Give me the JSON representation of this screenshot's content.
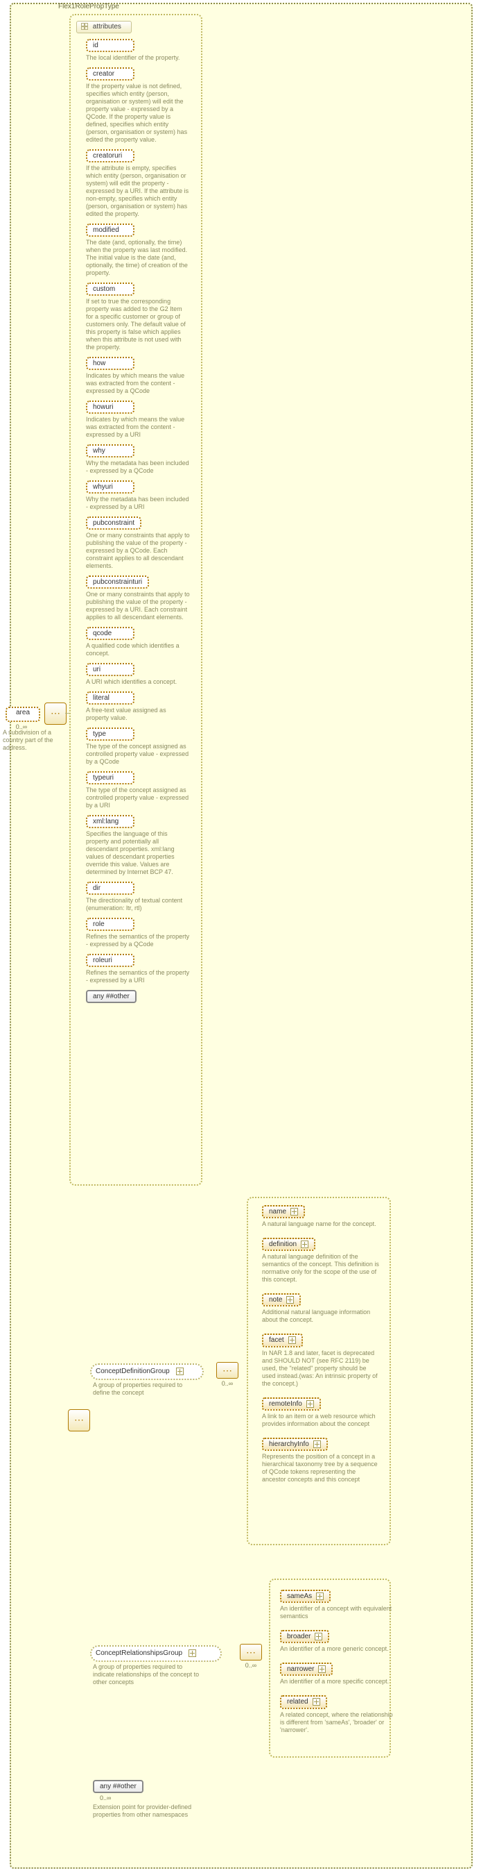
{
  "root_type": "Flex1RolePropType",
  "attributes_label": "attributes",
  "area": {
    "label": "area",
    "occ": "0..∞",
    "desc": "A subdivision of a country part of the address."
  },
  "attrs": [
    {
      "name": "id",
      "desc": "The local identifier of the property."
    },
    {
      "name": "creator",
      "desc": "If the property value is not defined, specifies which entity (person, organisation or system) will edit the property value - expressed by a QCode. If the property value is defined, specifies which entity (person, organisation or system) has edited the property value."
    },
    {
      "name": "creatoruri",
      "desc": "If the attribute is empty, specifies which entity (person, organisation or system) will edit the property - expressed by a URI. If the attribute is non-empty, specifies which entity (person, organisation or system) has edited the property."
    },
    {
      "name": "modified",
      "desc": "The date (and, optionally, the time) when the property was last modified. The initial value is the date (and, optionally, the time) of creation of the property."
    },
    {
      "name": "custom",
      "desc": "If set to true the corresponding property was added to the G2 Item for a specific customer or group of customers only. The default value of this property is false which applies when this attribute is not used with the property."
    },
    {
      "name": "how",
      "desc": "Indicates by which means the value was extracted from the content - expressed by a QCode"
    },
    {
      "name": "howuri",
      "desc": "Indicates by which means the value was extracted from the content - expressed by a URI"
    },
    {
      "name": "why",
      "desc": "Why the metadata has been included - expressed by a QCode"
    },
    {
      "name": "whyuri",
      "desc": "Why the metadata has been included - expressed by a URI"
    },
    {
      "name": "pubconstraint",
      "desc": "One or many constraints that apply to publishing the value of the property - expressed by a QCode. Each constraint applies to all descendant elements."
    },
    {
      "name": "pubconstrainturi",
      "desc": "One or many constraints that apply to publishing the value of the property - expressed by a URI. Each constraint applies to all descendant elements."
    },
    {
      "name": "qcode",
      "desc": "A qualified code which identifies a concept."
    },
    {
      "name": "uri",
      "desc": "A URI which identifies a concept."
    },
    {
      "name": "literal",
      "desc": "A free-text value assigned as property value."
    },
    {
      "name": "type",
      "desc": "The type of the concept assigned as controlled property value - expressed by a QCode"
    },
    {
      "name": "typeuri",
      "desc": "The type of the concept assigned as controlled property value - expressed by a URI"
    },
    {
      "name": "xml:lang",
      "desc": "Specifies the language of this property and potentially all descendant properties. xml:lang values of descendant properties override this value. Values are determined by Internet BCP 47."
    },
    {
      "name": "dir",
      "desc": "The directionality of textual content (enumeration: ltr, rtl)"
    },
    {
      "name": "role",
      "desc": "Refines the semantics of the property - expressed by a QCode"
    },
    {
      "name": "roleuri",
      "desc": "Refines the semantics of the property - expressed by a URI"
    }
  ],
  "any_other": "any ##other",
  "cdg": {
    "label": "ConceptDefinitionGroup",
    "desc": "A group of properties required to define the concept"
  },
  "crg": {
    "label": "ConceptRelationshipsGroup",
    "desc": "A group of properties required to indicate relationships of the concept to other concepts"
  },
  "zero_inf": "0..∞",
  "details1": [
    {
      "name": "name",
      "dotted": true,
      "desc": "A natural language name for the concept."
    },
    {
      "name": "definition",
      "dotted": true,
      "desc": "A natural language definition of the semantics of the concept. This definition is normative only for the scope of the use of this concept."
    },
    {
      "name": "note",
      "dotted": true,
      "desc": "Additional natural language information about the concept."
    },
    {
      "name": "facet",
      "dotted": true,
      "desc": "In NAR 1.8 and later, facet is deprecated and SHOULD NOT (see RFC 2119) be used, the \"related\" property should be used instead.(was: An intrinsic property of the concept.)"
    },
    {
      "name": "remoteInfo",
      "dotted": true,
      "desc": "A link to an item or a web resource which provides information about the concept"
    },
    {
      "name": "hierarchyInfo",
      "dotted": true,
      "desc": "Represents the position of a concept in a hierarchical taxonomy tree by a sequence of QCode tokens representing the ancestor concepts and this concept"
    }
  ],
  "details2": [
    {
      "name": "sameAs",
      "dotted": true,
      "desc": "An identifier of a concept with equivalent semantics"
    },
    {
      "name": "broader",
      "dotted": true,
      "desc": "An identifier of a more generic concept."
    },
    {
      "name": "narrower",
      "dotted": true,
      "desc": "An identifier of a more specific concept."
    },
    {
      "name": "related",
      "dotted": true,
      "desc": "A related concept, where the relationship is different from 'sameAs', 'broader' or 'narrower'."
    }
  ],
  "ext": {
    "label": "any ##other",
    "occ": "0..∞",
    "desc": "Extension point for provider-defined properties from other namespaces"
  }
}
